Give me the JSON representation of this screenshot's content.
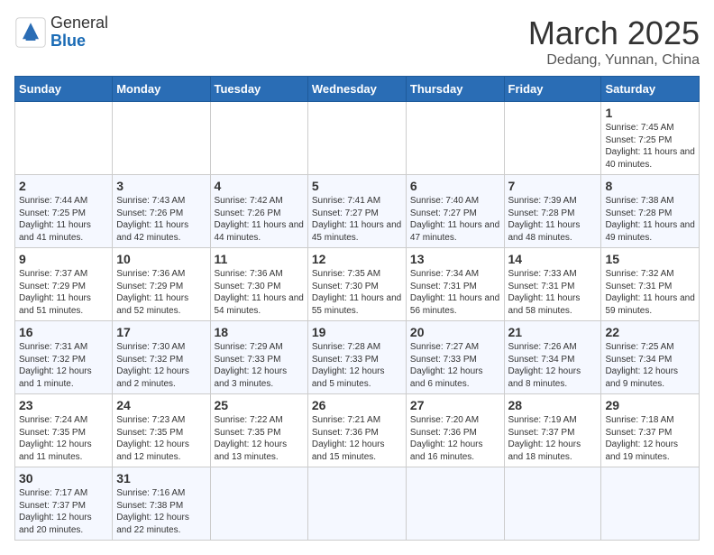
{
  "header": {
    "logo_general": "General",
    "logo_blue": "Blue",
    "title": "March 2025",
    "location": "Dedang, Yunnan, China"
  },
  "weekdays": [
    "Sunday",
    "Monday",
    "Tuesday",
    "Wednesday",
    "Thursday",
    "Friday",
    "Saturday"
  ],
  "weeks": [
    [
      {
        "day": "",
        "info": ""
      },
      {
        "day": "",
        "info": ""
      },
      {
        "day": "",
        "info": ""
      },
      {
        "day": "",
        "info": ""
      },
      {
        "day": "",
        "info": ""
      },
      {
        "day": "",
        "info": ""
      },
      {
        "day": "1",
        "info": "Sunrise: 7:45 AM\nSunset: 7:25 PM\nDaylight: 11 hours\nand 40 minutes."
      }
    ],
    [
      {
        "day": "2",
        "info": "Sunrise: 7:44 AM\nSunset: 7:25 PM\nDaylight: 11 hours\nand 41 minutes."
      },
      {
        "day": "3",
        "info": "Sunrise: 7:43 AM\nSunset: 7:26 PM\nDaylight: 11 hours\nand 42 minutes."
      },
      {
        "day": "4",
        "info": "Sunrise: 7:42 AM\nSunset: 7:26 PM\nDaylight: 11 hours\nand 44 minutes."
      },
      {
        "day": "5",
        "info": "Sunrise: 7:41 AM\nSunset: 7:27 PM\nDaylight: 11 hours\nand 45 minutes."
      },
      {
        "day": "6",
        "info": "Sunrise: 7:40 AM\nSunset: 7:27 PM\nDaylight: 11 hours\nand 47 minutes."
      },
      {
        "day": "7",
        "info": "Sunrise: 7:39 AM\nSunset: 7:28 PM\nDaylight: 11 hours\nand 48 minutes."
      },
      {
        "day": "8",
        "info": "Sunrise: 7:38 AM\nSunset: 7:28 PM\nDaylight: 11 hours\nand 49 minutes."
      }
    ],
    [
      {
        "day": "9",
        "info": "Sunrise: 7:37 AM\nSunset: 7:29 PM\nDaylight: 11 hours\nand 51 minutes."
      },
      {
        "day": "10",
        "info": "Sunrise: 7:36 AM\nSunset: 7:29 PM\nDaylight: 11 hours\nand 52 minutes."
      },
      {
        "day": "11",
        "info": "Sunrise: 7:36 AM\nSunset: 7:30 PM\nDaylight: 11 hours\nand 54 minutes."
      },
      {
        "day": "12",
        "info": "Sunrise: 7:35 AM\nSunset: 7:30 PM\nDaylight: 11 hours\nand 55 minutes."
      },
      {
        "day": "13",
        "info": "Sunrise: 7:34 AM\nSunset: 7:31 PM\nDaylight: 11 hours\nand 56 minutes."
      },
      {
        "day": "14",
        "info": "Sunrise: 7:33 AM\nSunset: 7:31 PM\nDaylight: 11 hours\nand 58 minutes."
      },
      {
        "day": "15",
        "info": "Sunrise: 7:32 AM\nSunset: 7:31 PM\nDaylight: 11 hours\nand 59 minutes."
      }
    ],
    [
      {
        "day": "16",
        "info": "Sunrise: 7:31 AM\nSunset: 7:32 PM\nDaylight: 12 hours\nand 1 minute."
      },
      {
        "day": "17",
        "info": "Sunrise: 7:30 AM\nSunset: 7:32 PM\nDaylight: 12 hours\nand 2 minutes."
      },
      {
        "day": "18",
        "info": "Sunrise: 7:29 AM\nSunset: 7:33 PM\nDaylight: 12 hours\nand 3 minutes."
      },
      {
        "day": "19",
        "info": "Sunrise: 7:28 AM\nSunset: 7:33 PM\nDaylight: 12 hours\nand 5 minutes."
      },
      {
        "day": "20",
        "info": "Sunrise: 7:27 AM\nSunset: 7:33 PM\nDaylight: 12 hours\nand 6 minutes."
      },
      {
        "day": "21",
        "info": "Sunrise: 7:26 AM\nSunset: 7:34 PM\nDaylight: 12 hours\nand 8 minutes."
      },
      {
        "day": "22",
        "info": "Sunrise: 7:25 AM\nSunset: 7:34 PM\nDaylight: 12 hours\nand 9 minutes."
      }
    ],
    [
      {
        "day": "23",
        "info": "Sunrise: 7:24 AM\nSunset: 7:35 PM\nDaylight: 12 hours\nand 11 minutes."
      },
      {
        "day": "24",
        "info": "Sunrise: 7:23 AM\nSunset: 7:35 PM\nDaylight: 12 hours\nand 12 minutes."
      },
      {
        "day": "25",
        "info": "Sunrise: 7:22 AM\nSunset: 7:35 PM\nDaylight: 12 hours\nand 13 minutes."
      },
      {
        "day": "26",
        "info": "Sunrise: 7:21 AM\nSunset: 7:36 PM\nDaylight: 12 hours\nand 15 minutes."
      },
      {
        "day": "27",
        "info": "Sunrise: 7:20 AM\nSunset: 7:36 PM\nDaylight: 12 hours\nand 16 minutes."
      },
      {
        "day": "28",
        "info": "Sunrise: 7:19 AM\nSunset: 7:37 PM\nDaylight: 12 hours\nand 18 minutes."
      },
      {
        "day": "29",
        "info": "Sunrise: 7:18 AM\nSunset: 7:37 PM\nDaylight: 12 hours\nand 19 minutes."
      }
    ],
    [
      {
        "day": "30",
        "info": "Sunrise: 7:17 AM\nSunset: 7:37 PM\nDaylight: 12 hours\nand 20 minutes."
      },
      {
        "day": "31",
        "info": "Sunrise: 7:16 AM\nSunset: 7:38 PM\nDaylight: 12 hours\nand 22 minutes."
      },
      {
        "day": "",
        "info": ""
      },
      {
        "day": "",
        "info": ""
      },
      {
        "day": "",
        "info": ""
      },
      {
        "day": "",
        "info": ""
      },
      {
        "day": "",
        "info": ""
      }
    ]
  ]
}
